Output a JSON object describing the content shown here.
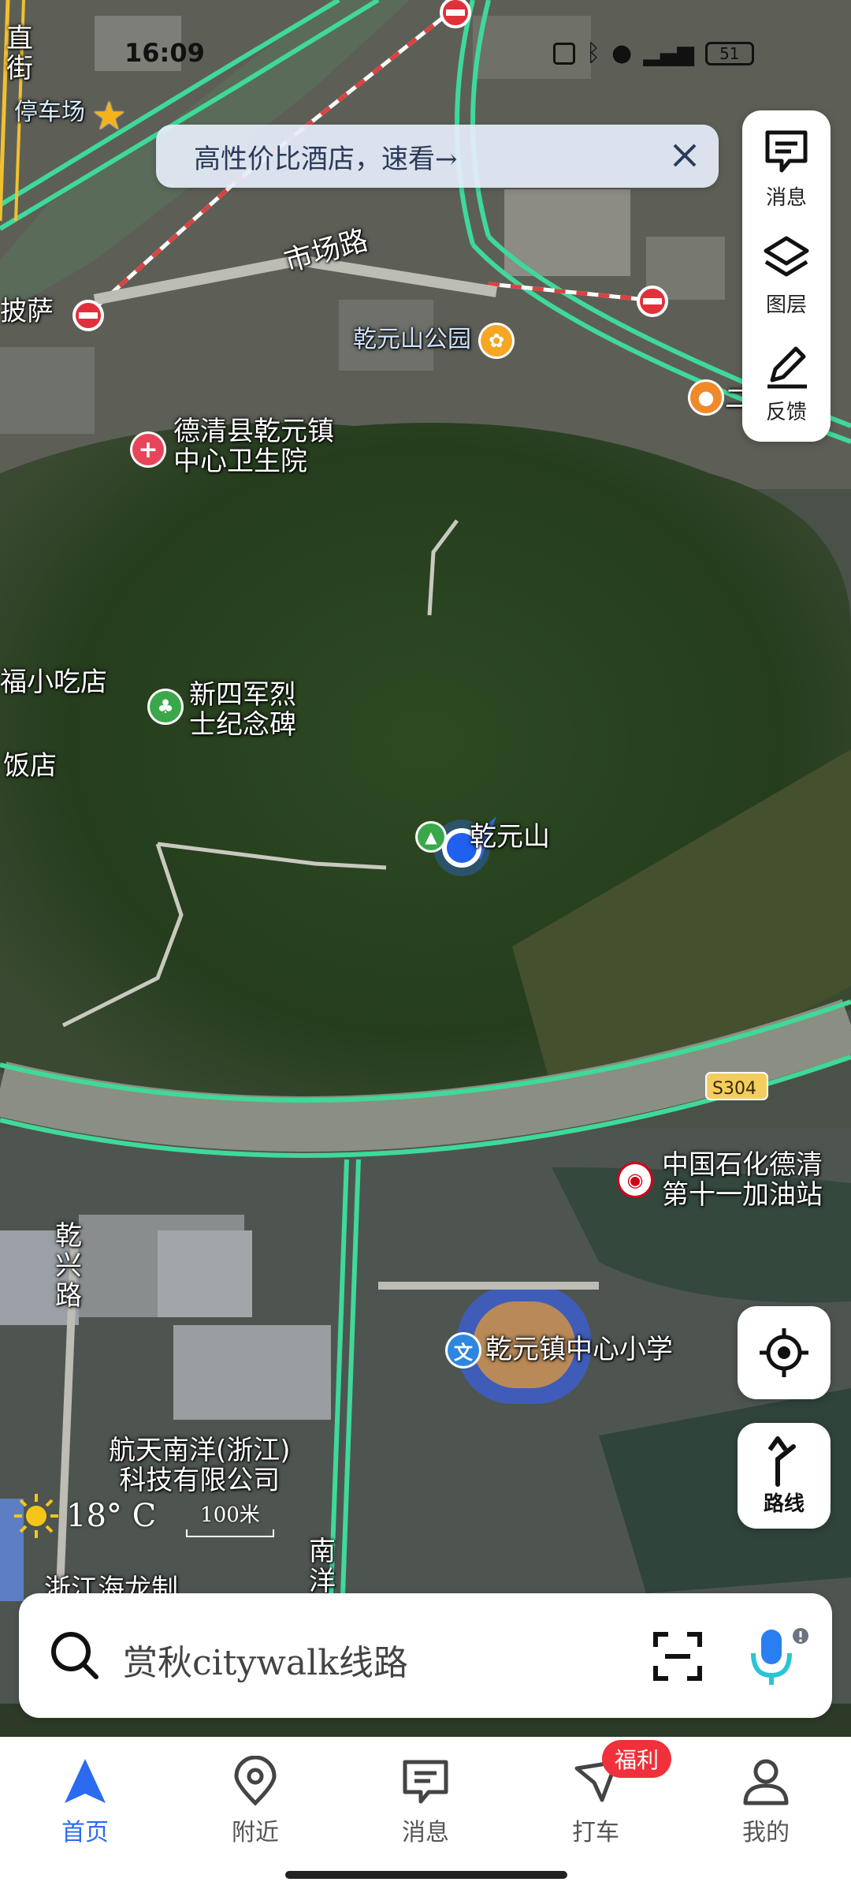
{
  "status_bar": {
    "time": "16:09",
    "battery": "51"
  },
  "banner": {
    "text": "高性价比酒店，速看→"
  },
  "tool_panel": [
    {
      "label": "消息",
      "icon": "message-icon"
    },
    {
      "label": "图层",
      "icon": "layers-icon"
    },
    {
      "label": "反馈",
      "icon": "pen-icon"
    }
  ],
  "map": {
    "labels": {
      "street_1": "直",
      "street_2": "街",
      "parking": "停车场",
      "pizza": "披萨",
      "market_road": "市场路",
      "park": "乾元山公园",
      "clinic": "德清县乾元镇\n中心卫生院",
      "snack": "福小吃店",
      "memorial": "新四军烈\n士纪念碑",
      "restaurant": "饭店",
      "mountain": "乾元山",
      "road_shield": "S304",
      "gas_station": "中国石化德清\n第十一加油站",
      "qianxing_road": "乾\n兴\n路",
      "school": "乾元镇中心小学",
      "company": "航天南洋(浙江)\n科技有限公司",
      "south_label": "南\n洋",
      "bottom_left": "浙江海龙制",
      "right_edge": "二"
    },
    "weather": {
      "temp": "18° C",
      "icon": "sun-icon"
    },
    "scale": "100米"
  },
  "buttons": {
    "locate_icon": "locate-icon",
    "route_label": "路线"
  },
  "search": {
    "placeholder": "赏秋citywalk线路"
  },
  "nav": {
    "items": [
      {
        "label": "首页",
        "active": true
      },
      {
        "label": "附近"
      },
      {
        "label": "消息"
      },
      {
        "label": "打车"
      },
      {
        "label": "我的"
      }
    ],
    "badge": "福利"
  },
  "colors": {
    "accent": "#2a6bf0",
    "road": "#3fd99a",
    "badge": "#f0303a"
  }
}
